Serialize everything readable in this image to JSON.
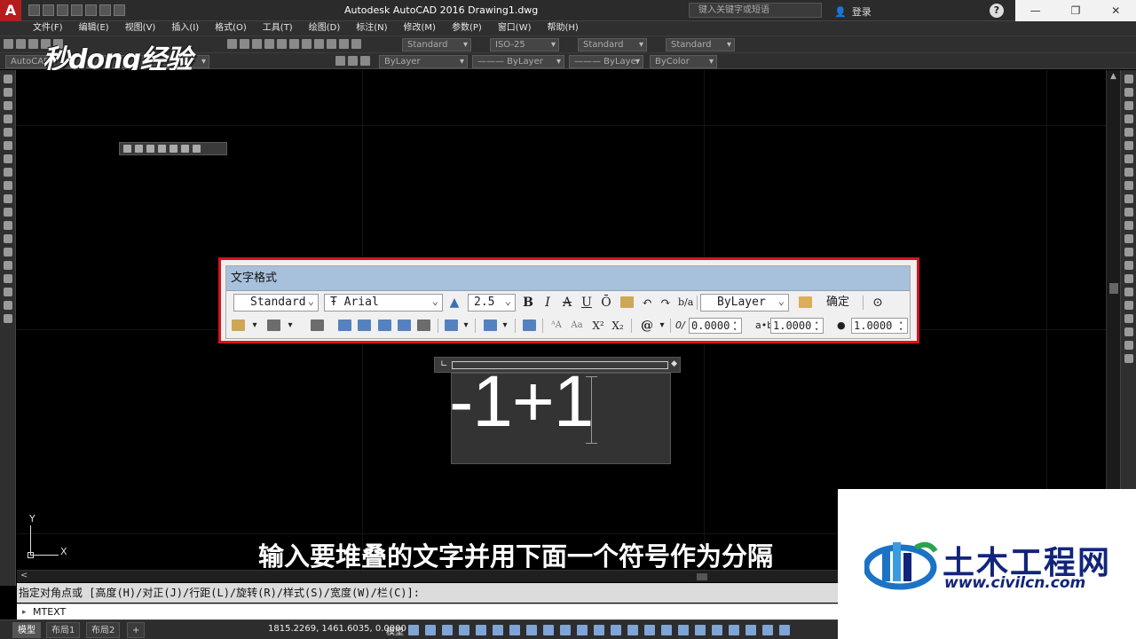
{
  "titlebar": {
    "logo": "A",
    "title": "Autodesk AutoCAD 2016    Drawing1.dwg",
    "search_placeholder": "键入关键字或短语",
    "login": "登录",
    "help": "?",
    "window_controls": [
      "—",
      "❐",
      "✕"
    ]
  },
  "menubar": {
    "items": [
      "文件(F)",
      "编辑(E)",
      "视图(V)",
      "插入(I)",
      "格式(O)",
      "工具(T)",
      "绘图(D)",
      "标注(N)",
      "修改(M)",
      "参数(P)",
      "窗口(W)",
      "帮助(H)"
    ]
  },
  "toolbar1": {
    "text_style": "Standard",
    "dim_style": "ISO-25",
    "table_style": "Standard",
    "mleader_style": "Standard"
  },
  "toolbar2": {
    "workspace": "AutoCAD",
    "layer": "ByLayer",
    "linetype": "——— ByLayer",
    "lineweight": "——— ByLayer",
    "color": "ByColor"
  },
  "watermark": "秒dong经验",
  "text_format": {
    "title": "文字格式",
    "style": "Standard",
    "font": "Arial",
    "font_prefix": "Ŧ",
    "height": "2.5",
    "bold": "B",
    "italic": "I",
    "strike": "A",
    "underline": "U",
    "overline": "Ō",
    "color": "ByLayer",
    "ok": "确定",
    "oblique_label": "0/",
    "oblique": "0.0000",
    "tracking_label": "a•b",
    "tracking": "1.0000",
    "width_label": "●",
    "width_factor": "1.0000",
    "symbol": "@"
  },
  "editor": {
    "text": "-1+1"
  },
  "ucs": {
    "x": "X",
    "y": "Y"
  },
  "subtitle": "输入要堆叠的文字并用下面一个符号作为分隔",
  "brand": {
    "name": "土木工程网",
    "url": "www.civilcn.com"
  },
  "command": {
    "history": "指定对角点或 [高度(H)/对正(J)/行距(L)/旋转(R)/样式(S)/宽度(W)/栏(C)]:",
    "current": "MTEXT"
  },
  "statusbar": {
    "tabs": [
      "模型",
      "布局1",
      "布局2",
      "+"
    ],
    "coords": "1815.2269, 1461.6035, 0.0000",
    "model": "模型"
  },
  "colors": {
    "highlight_border": "#d4141a",
    "dialog_header": "#a7c0dc",
    "brand_blue": "#12257a"
  }
}
